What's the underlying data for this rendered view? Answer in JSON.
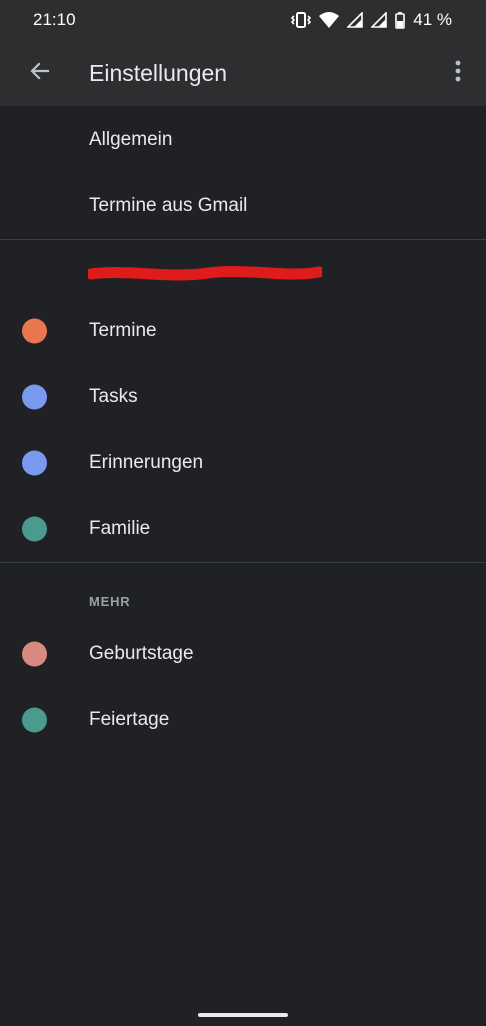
{
  "status_bar": {
    "time": "21:10",
    "battery": "41 %",
    "icons": [
      "vibrate-icon",
      "wifi-icon",
      "signal-icon",
      "signal-icon",
      "battery-icon"
    ]
  },
  "app_bar": {
    "title": "Einstellungen",
    "back_icon": "arrow-back-icon",
    "menu_icon": "more-vert-icon"
  },
  "general": {
    "items": [
      {
        "label": "Allgemein"
      },
      {
        "label": "Termine aus Gmail"
      }
    ]
  },
  "account": {
    "items": [
      {
        "label": "Termine",
        "color": "#e8774f"
      },
      {
        "label": "Tasks",
        "color": "#7a9af0"
      },
      {
        "label": "Erinnerungen",
        "color": "#7a9af0"
      },
      {
        "label": "Familie",
        "color": "#4a9a8d"
      }
    ]
  },
  "more": {
    "header": "MEHR",
    "items": [
      {
        "label": "Geburtstage",
        "color": "#d88a80"
      },
      {
        "label": "Feiertage",
        "color": "#4a9a8d"
      }
    ]
  },
  "colors": {
    "background": "#202124",
    "app_bar": "#2d2e30",
    "redaction": "#e01b1b"
  }
}
